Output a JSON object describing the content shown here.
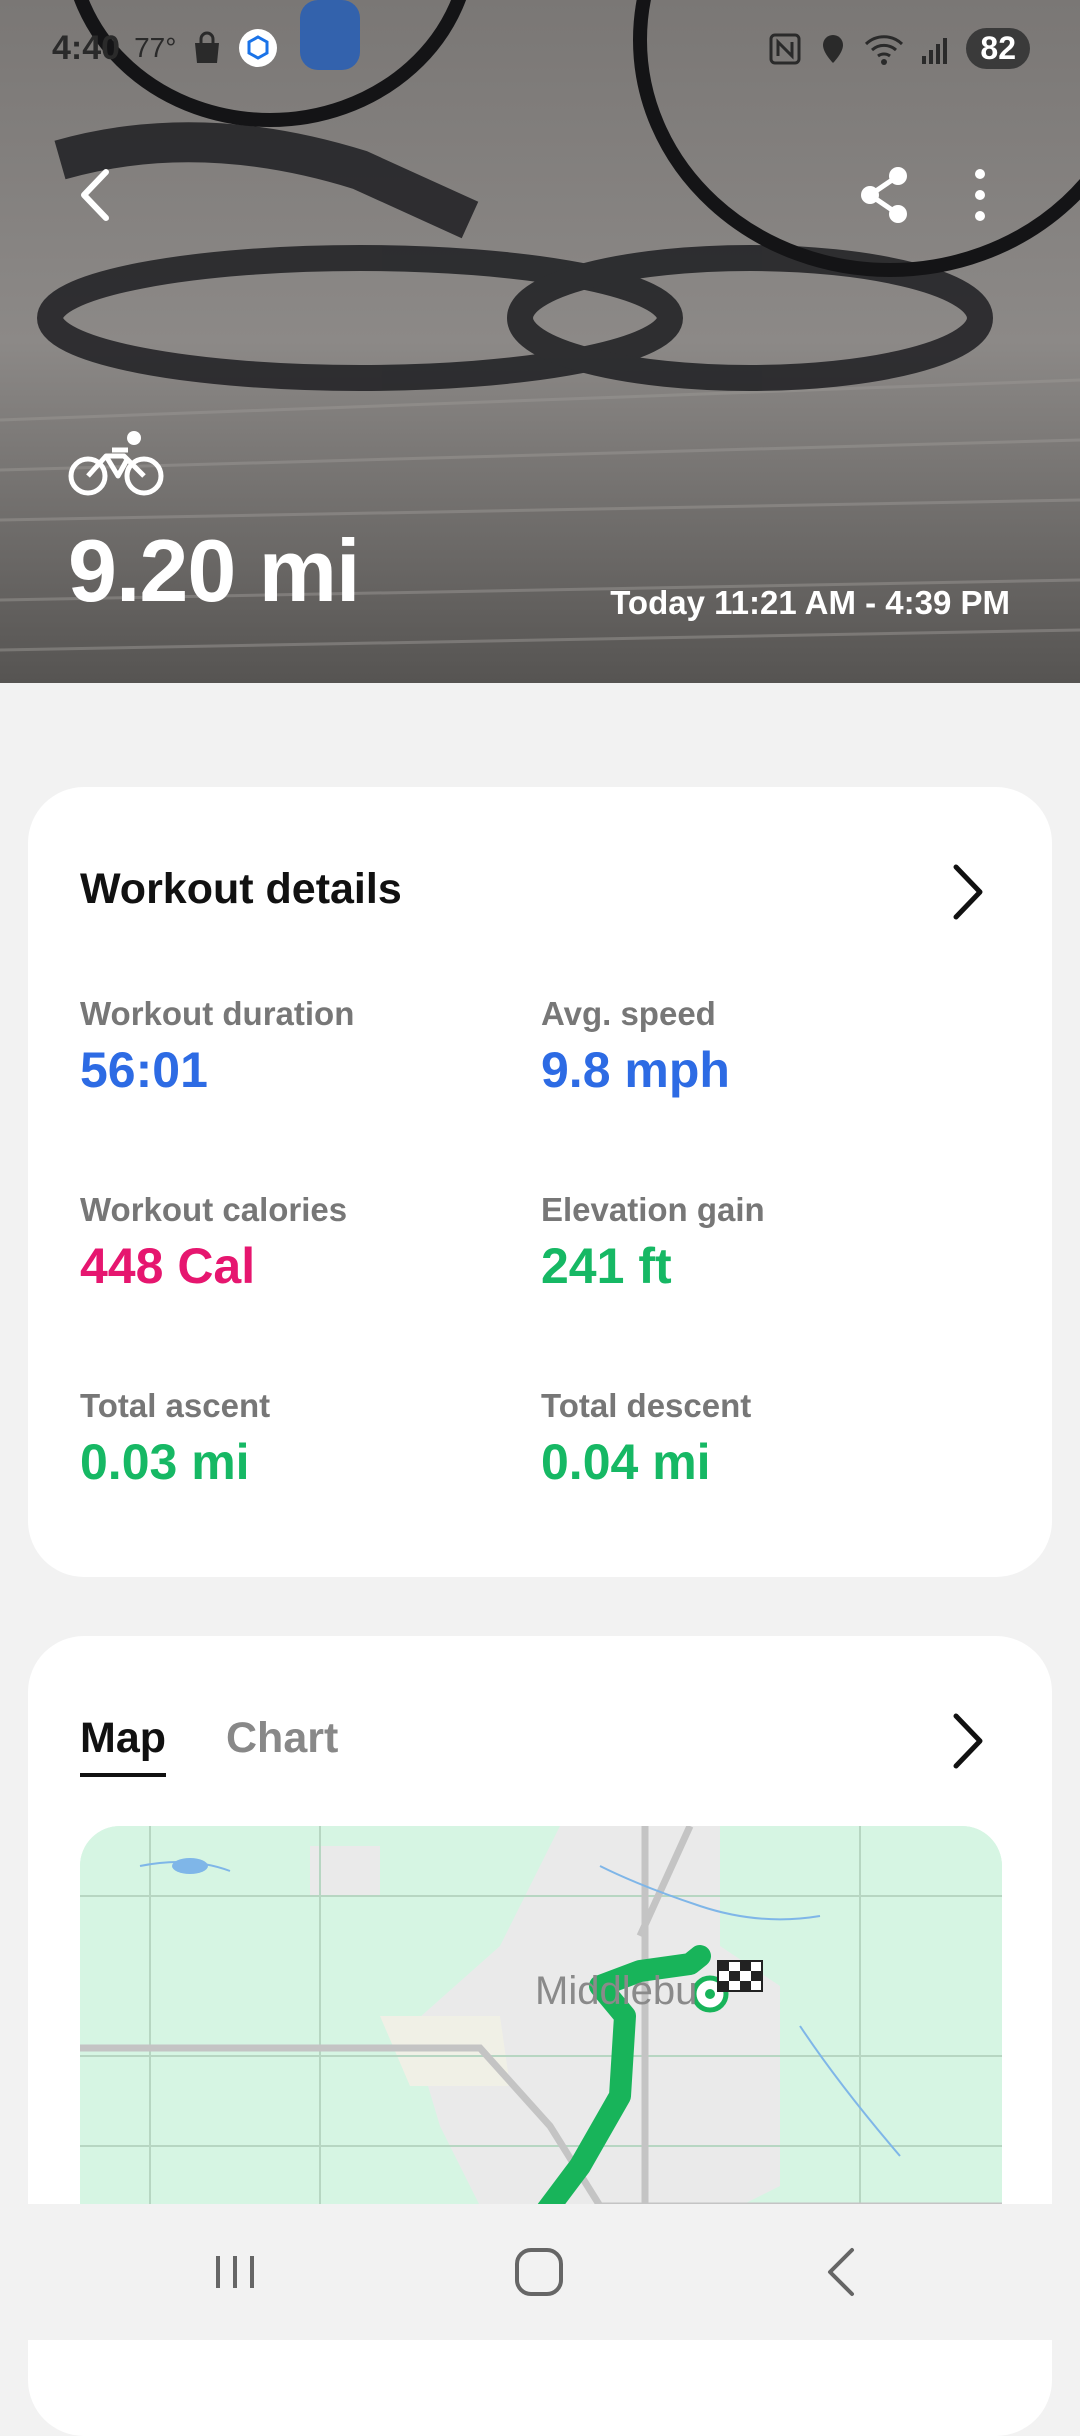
{
  "status_bar": {
    "time": "4:40",
    "temperature": "77°",
    "battery": "82"
  },
  "header": {
    "activity_icon": "cycling-icon",
    "distance": "9.20 mi",
    "time_range": "Today 11:21 AM - 4:39 PM"
  },
  "workout_details": {
    "title": "Workout details",
    "metrics": [
      {
        "label": "Workout duration",
        "value": "56:01",
        "color": "#2d6be4"
      },
      {
        "label": "Avg. speed",
        "value": "9.8 mph",
        "color": "#2d6be4"
      },
      {
        "label": "Workout calories",
        "value": "448 Cal",
        "color": "#e6166f"
      },
      {
        "label": "Elevation gain",
        "value": "241 ft",
        "color": "#16b864"
      },
      {
        "label": "Total ascent",
        "value": "0.03 mi",
        "color": "#16b864"
      },
      {
        "label": "Total descent",
        "value": "0.04 mi",
        "color": "#16b864"
      }
    ]
  },
  "route_card": {
    "tabs": [
      {
        "label": "Map",
        "active": true
      },
      {
        "label": "Chart",
        "active": false
      }
    ],
    "map_label": "Middlebu"
  },
  "colors": {
    "route": "#18b45a",
    "map_bg": "#d6f5e3"
  }
}
